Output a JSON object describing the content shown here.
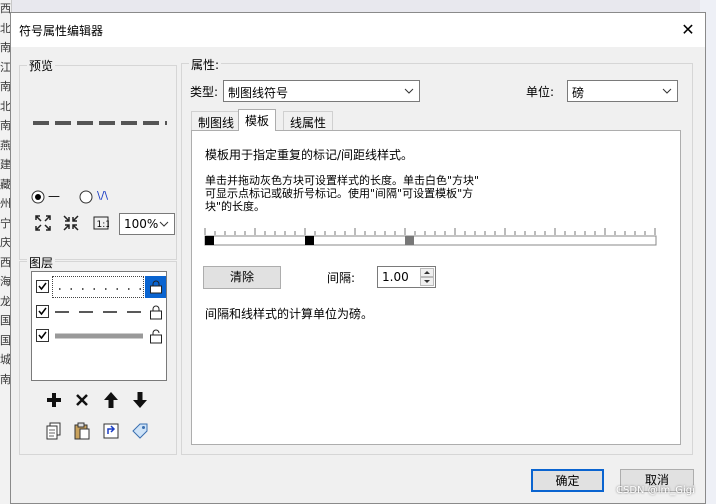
{
  "background": {
    "left_chars": [
      "西",
      "北",
      "南",
      "江",
      "南",
      "北",
      "南",
      "燕",
      "建",
      "藏",
      "州",
      "宁",
      "庆",
      "西",
      "海",
      "龙",
      "国",
      "国",
      "城",
      "南"
    ]
  },
  "dialog": {
    "title": "符号属性编辑器",
    "close_glyph": "✕",
    "preview": {
      "label": "预览",
      "radio_a_glyph": "—",
      "radio_b_glyph": "\\/\\",
      "zoom_value": "100%"
    },
    "layers": {
      "label": "图层",
      "rows": [
        {
          "checked": true,
          "style": "dotted",
          "selected": true
        },
        {
          "checked": true,
          "style": "dashed",
          "selected": false
        },
        {
          "checked": true,
          "style": "solid-gray",
          "selected": false
        }
      ]
    },
    "properties": {
      "label": "属性:",
      "type_label": "类型:",
      "type_value": "制图线符号",
      "unit_label": "单位:",
      "unit_value": "磅",
      "tabs": [
        {
          "label": "制图线",
          "active": false
        },
        {
          "label": "模板",
          "active": true
        },
        {
          "label": "线属性",
          "active": false
        }
      ],
      "template": {
        "desc1": "模板用于指定重复的标记/间距线样式。",
        "desc2": "单击并拖动灰色方块可设置样式的长度。单击白色\"方块\"",
        "desc3": "可显示点标记或破折号标记。使用\"间隔\"可设置模板\"方",
        "desc4": "块\"的长度。",
        "clear_label": "清除",
        "interval_label": "间隔:",
        "interval_value": "1.00",
        "note": "间隔和线样式的计算单位为磅。"
      }
    },
    "ok_label": "确定",
    "cancel_label": "取消"
  },
  "watermark": "CSDN @lm_Gigi"
}
